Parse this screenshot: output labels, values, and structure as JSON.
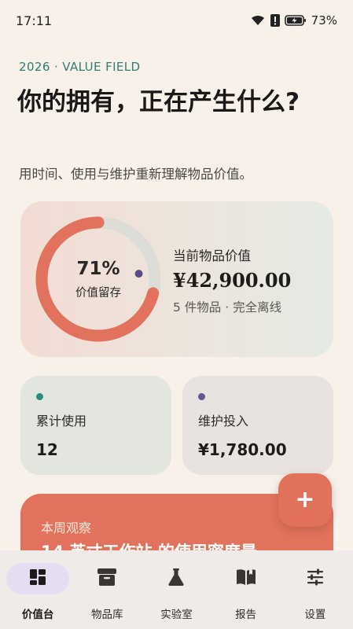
{
  "status_bar": {
    "time": "17:11",
    "battery": "73%",
    "wifi_icon": "wifi-icon",
    "alert_icon": "alert-icon",
    "battery_icon": "battery-charging-icon"
  },
  "header": {
    "eyebrow": "2026 · VALUE FIELD",
    "title": "你的拥有，正在产生什么?",
    "subtitle": "用时间、使用与维护重新理解物品价值。"
  },
  "value_card": {
    "retention_percent": 71,
    "retention_text": "71%",
    "retention_label": "价值留存",
    "label": "当前物品价值",
    "amount": "¥42,900.00",
    "meta": "5 件物品 · 完全离线"
  },
  "stats": {
    "usage": {
      "label": "累计使用",
      "value": "12",
      "dot_color": "#2F8A78"
    },
    "maintenance": {
      "label": "维护投入",
      "value": "¥1,780.00",
      "dot_color": "#6A5592"
    }
  },
  "observation": {
    "eyebrow": "本周观察",
    "title": "14 英寸工作站 的使用密度最"
  },
  "fab": {
    "label": "+",
    "icon": "plus-icon"
  },
  "nav": {
    "items": [
      {
        "label": "价值台",
        "icon": "dashboard-grid-icon",
        "active": true
      },
      {
        "label": "物品库",
        "icon": "archive-box-icon",
        "active": false
      },
      {
        "label": "实验室",
        "icon": "flask-icon",
        "active": false
      },
      {
        "label": "报告",
        "icon": "book-open-icon",
        "active": false
      },
      {
        "label": "设置",
        "icon": "sliders-icon",
        "active": false
      }
    ]
  },
  "colors": {
    "accent": "#E2725D",
    "ring_track": "#DCDDD6",
    "teal": "#2F7D73",
    "purple_dot": "#5A4A86",
    "background": "#F7F1EA",
    "active_nav": "#E7DDF3"
  }
}
